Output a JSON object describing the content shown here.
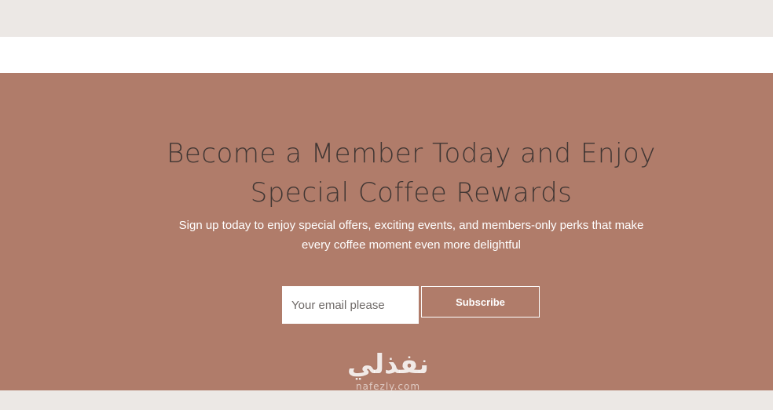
{
  "hero": {
    "headline_line1": "Become a Member Today and Enjoy",
    "headline_line2": "Special Coffee Rewards",
    "subtext_line1": "Sign up today to enjoy special offers, exciting events, and members-only perks that make",
    "subtext_line2": "every coffee moment even more delightful"
  },
  "signup": {
    "email_placeholder": "Your email please",
    "email_value": "",
    "subscribe_label": "Subscribe"
  },
  "watermark": {
    "logo_text": "نفذلي",
    "url_text": "nafezly.com"
  },
  "colors": {
    "page_background": "#ece8e5",
    "band_white": "#ffffff",
    "hero_background": "#b07c6a",
    "headline_text": "#403633",
    "subtext": "#ffffff"
  }
}
